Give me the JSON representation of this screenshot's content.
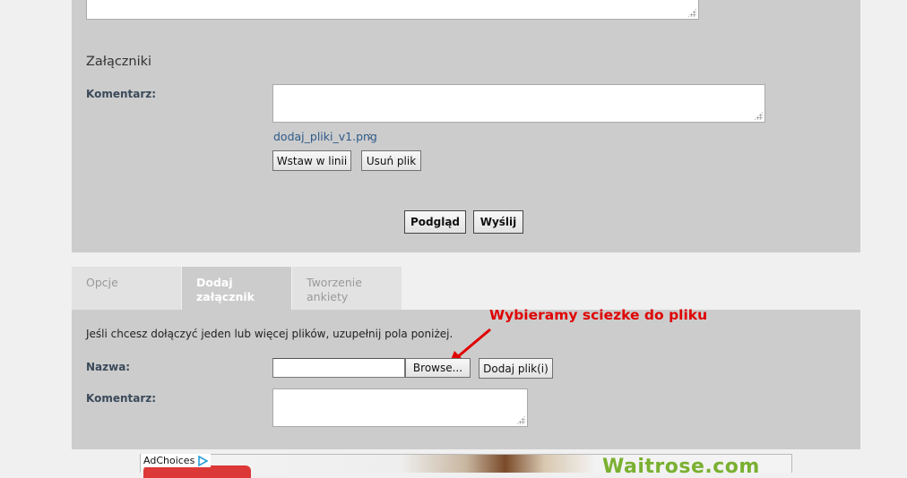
{
  "attachments": {
    "heading": "Załączniki",
    "comment_label": "Komentarz:",
    "filename": "dodaj_pliki_v1.png",
    "filename_suffix": ":",
    "insert_inline_label": "Wstaw w linii",
    "remove_file_label": "Usuń plik"
  },
  "actions": {
    "preview_label": "Podgląd",
    "send_label": "Wyślij"
  },
  "tabs": [
    {
      "label": "Opcje",
      "active": false
    },
    {
      "label": "Dodaj załącznik",
      "active": true
    },
    {
      "label": "Tworzenie ankiety",
      "active": false
    }
  ],
  "upload": {
    "info_text": "Jeśli chcesz dołączyć jeden lub więcej plików, uzupełnij pola poniżej.",
    "name_label": "Nazwa:",
    "file_value": "",
    "browse_label": "Browse...",
    "add_file_label": "Dodaj plik(i)",
    "comment_label": "Komentarz:"
  },
  "annotation": {
    "text": "Wybieramy sciezke do pliku",
    "color": "#e00000"
  },
  "ad": {
    "adchoices_label": "AdChoices",
    "brand_text": "Waitrose.com"
  },
  "colors": {
    "panel": "#cccccc",
    "page_bg": "#f0f0f0",
    "link": "#2e5a8a",
    "label": "#3a4a5a",
    "brand": "#7ab030"
  }
}
